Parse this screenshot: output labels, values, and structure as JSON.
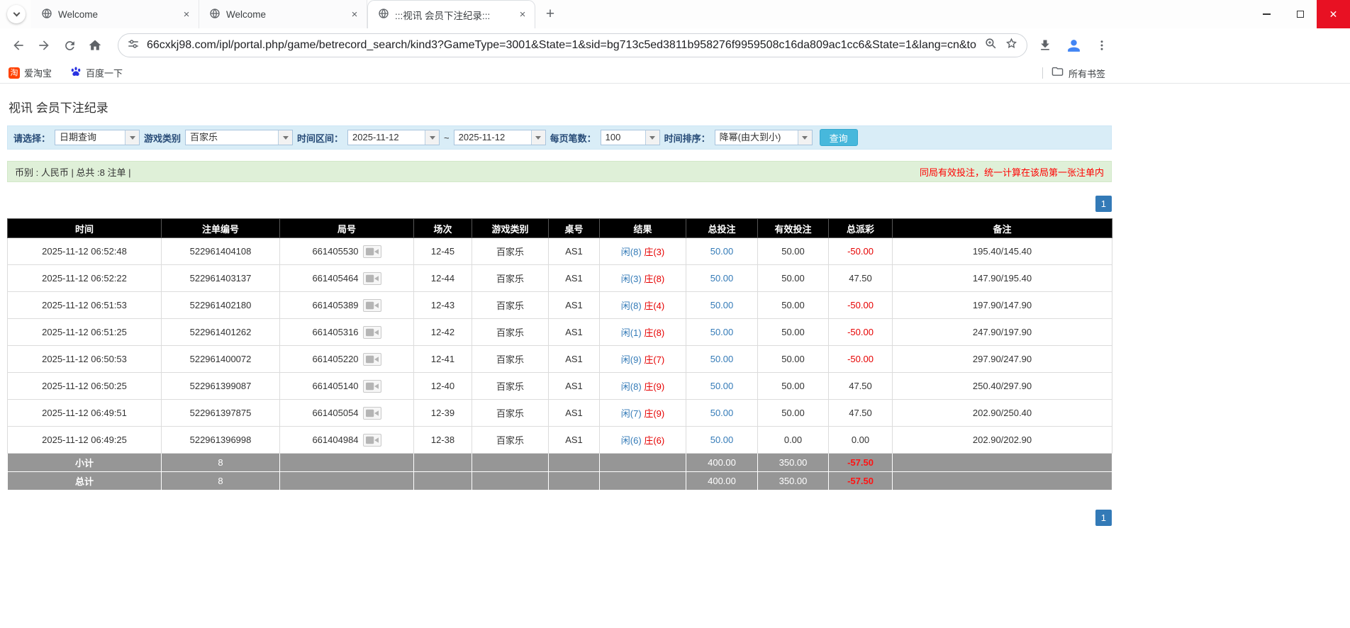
{
  "browser": {
    "tabs": [
      {
        "title": "Welcome"
      },
      {
        "title": "Welcome"
      },
      {
        "title": ":::视讯 会员下注纪录:::"
      }
    ],
    "close_tab_glyph": "×",
    "new_tab_glyph": "+",
    "window_close_glyph": "✕",
    "url": "66cxkj98.com/ipl/portal.php/game/betrecord_search/kind3?GameType=3001&State=1&sid=bg713c5ed3811b958276f9959508c16da809ac1cc6&State=1&lang=cn&toke...",
    "bookmarks": {
      "taobao_icon_text": "淘",
      "items": [
        "爱淘宝",
        "百度一下"
      ],
      "all_bookmarks": "所有书签"
    }
  },
  "page": {
    "title": "视讯 会员下注纪录",
    "filters": {
      "select_label": "请选择：",
      "select_value": "日期查询",
      "game_type_label": "游戏类别",
      "game_type_value": "百家乐",
      "date_range_label": "时间区间：",
      "date_from": "2025-11-12",
      "range_separator": "~",
      "date_to": "2025-11-12",
      "page_size_label": "每页笔数：",
      "page_size_value": "100",
      "sort_label": "时间排序：",
      "sort_value": "降幂(由大到小)",
      "search_button": "查询"
    },
    "summary": {
      "left": "币别 : 人民币 | 总共 :8 注单 |",
      "right": "同局有效投注，统一计算在该局第一张注单内"
    },
    "pagination": "1",
    "table": {
      "headers": [
        "时间",
        "注单编号",
        "局号",
        "场次",
        "游戏类别",
        "桌号",
        "结果",
        "总投注",
        "有效投注",
        "总派彩",
        "备注"
      ],
      "rows": [
        {
          "time": "2025-11-12 06:52:48",
          "bet_id": "522961404108",
          "round": "661405530",
          "session": "12-45",
          "game": "百家乐",
          "table_no": "AS1",
          "player": "闲(8)",
          "banker": "庄(3)",
          "total_bet": "50.00",
          "valid_bet": "50.00",
          "payout": "-50.00",
          "note": "195.40/145.40"
        },
        {
          "time": "2025-11-12 06:52:22",
          "bet_id": "522961403137",
          "round": "661405464",
          "session": "12-44",
          "game": "百家乐",
          "table_no": "AS1",
          "player": "闲(3)",
          "banker": "庄(8)",
          "total_bet": "50.00",
          "valid_bet": "50.00",
          "payout": "47.50",
          "note": "147.90/195.40"
        },
        {
          "time": "2025-11-12 06:51:53",
          "bet_id": "522961402180",
          "round": "661405389",
          "session": "12-43",
          "game": "百家乐",
          "table_no": "AS1",
          "player": "闲(8)",
          "banker": "庄(4)",
          "total_bet": "50.00",
          "valid_bet": "50.00",
          "payout": "-50.00",
          "note": "197.90/147.90"
        },
        {
          "time": "2025-11-12 06:51:25",
          "bet_id": "522961401262",
          "round": "661405316",
          "session": "12-42",
          "game": "百家乐",
          "table_no": "AS1",
          "player": "闲(1)",
          "banker": "庄(8)",
          "total_bet": "50.00",
          "valid_bet": "50.00",
          "payout": "-50.00",
          "note": "247.90/197.90"
        },
        {
          "time": "2025-11-12 06:50:53",
          "bet_id": "522961400072",
          "round": "661405220",
          "session": "12-41",
          "game": "百家乐",
          "table_no": "AS1",
          "player": "闲(9)",
          "banker": "庄(7)",
          "total_bet": "50.00",
          "valid_bet": "50.00",
          "payout": "-50.00",
          "note": "297.90/247.90"
        },
        {
          "time": "2025-11-12 06:50:25",
          "bet_id": "522961399087",
          "round": "661405140",
          "session": "12-40",
          "game": "百家乐",
          "table_no": "AS1",
          "player": "闲(8)",
          "banker": "庄(9)",
          "total_bet": "50.00",
          "valid_bet": "50.00",
          "payout": "47.50",
          "note": "250.40/297.90"
        },
        {
          "time": "2025-11-12 06:49:51",
          "bet_id": "522961397875",
          "round": "661405054",
          "session": "12-39",
          "game": "百家乐",
          "table_no": "AS1",
          "player": "闲(7)",
          "banker": "庄(9)",
          "total_bet": "50.00",
          "valid_bet": "50.00",
          "payout": "47.50",
          "note": "202.90/250.40"
        },
        {
          "time": "2025-11-12 06:49:25",
          "bet_id": "522961396998",
          "round": "661404984",
          "session": "12-38",
          "game": "百家乐",
          "table_no": "AS1",
          "player": "闲(6)",
          "banker": "庄(6)",
          "total_bet": "50.00",
          "valid_bet": "0.00",
          "payout": "0.00",
          "note": "202.90/202.90"
        }
      ],
      "subtotal": {
        "label": "小计",
        "count": "8",
        "total_bet": "400.00",
        "valid_bet": "350.00",
        "payout": "-57.50"
      },
      "total": {
        "label": "总计",
        "count": "8",
        "total_bet": "400.00",
        "valid_bet": "350.00",
        "payout": "-57.50"
      }
    }
  }
}
